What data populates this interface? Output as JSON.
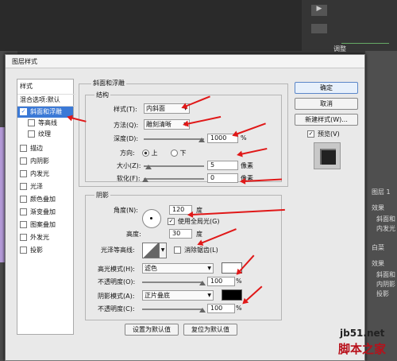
{
  "dialog": {
    "title": "图层样式"
  },
  "style_list": {
    "header": "样式",
    "blend_options": "混合选项:默认",
    "items": [
      {
        "label": "斜面和浮雕",
        "checked": true,
        "selected": true
      },
      {
        "label": "等高线",
        "checked": false
      },
      {
        "label": "纹理",
        "checked": false
      },
      {
        "label": "描边",
        "checked": false
      },
      {
        "label": "内阴影",
        "checked": false
      },
      {
        "label": "内发光",
        "checked": false
      },
      {
        "label": "光泽",
        "checked": false
      },
      {
        "label": "颜色叠加",
        "checked": false
      },
      {
        "label": "渐变叠加",
        "checked": false
      },
      {
        "label": "图案叠加",
        "checked": false
      },
      {
        "label": "外发光",
        "checked": false
      },
      {
        "label": "投影",
        "checked": false
      }
    ]
  },
  "bevel": {
    "section_title": "斜面和浮雕",
    "structure_title": "结构",
    "style_label": "样式(T):",
    "style_value": "内斜面",
    "technique_label": "方法(Q):",
    "technique_value": "雕刻清晰",
    "depth_label": "深度(D):",
    "depth_value": "1000",
    "depth_unit": "%",
    "direction_label": "方向:",
    "dir_up": "上",
    "dir_down": "下",
    "size_label": "大小(Z):",
    "size_value": "5",
    "size_unit": "像素",
    "soften_label": "软化(F):",
    "soften_value": "0",
    "soften_unit": "像素"
  },
  "shading": {
    "title": "阴影",
    "angle_label": "角度(N):",
    "angle_value": "120",
    "angle_unit": "度",
    "global_light": "使用全局光(G)",
    "altitude_label": "高度:",
    "altitude_value": "30",
    "altitude_unit": "度",
    "gloss_label": "光泽等高线:",
    "antialias": "消除锯齿(L)",
    "highlight_label": "高光模式(H):",
    "highlight_mode": "滤色",
    "highlight_color": "#ffffff",
    "hl_opacity_label": "不透明度(O):",
    "hl_opacity": "100",
    "shadow_label": "阴影模式(A):",
    "shadow_mode": "正片叠底",
    "shadow_color": "#000000",
    "sh_opacity_label": "不透明度(C):",
    "sh_opacity": "100",
    "percent": "%"
  },
  "buttons": {
    "ok": "确定",
    "cancel": "取消",
    "new_style": "新建样式(W)...",
    "preview": "预览(V)",
    "make_default": "设置为默认值",
    "reset_default": "复位为默认值"
  },
  "background": {
    "panel_tab": "调整",
    "layer": "图层 1",
    "effects": "效果",
    "fx1": "斜面和",
    "fx2": "内发光",
    "bg_layer": "白菜",
    "effects2": "效果",
    "fx3": "斜面和",
    "fx4": "内阴影",
    "fx5": "投影"
  },
  "watermark": {
    "site": "jb51.net",
    "name": "脚本之家"
  }
}
